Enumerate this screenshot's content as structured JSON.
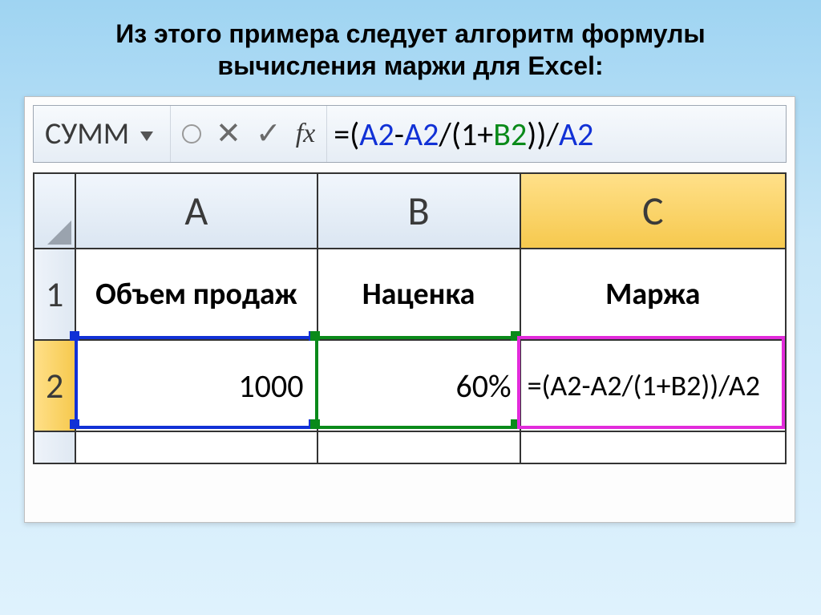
{
  "title": "Из этого примера следует алгоритм формулы вычисления маржи для Excel:",
  "namebox": "СУММ",
  "formula": {
    "eq": "=",
    "lpar": "(",
    "a2_1": "A2",
    "minus": "-",
    "a2_2": "A2",
    "slash1": "/",
    "lpar2": "(",
    "one": "1",
    "plus": "+",
    "b2": "B2",
    "rpar2": ")",
    "rpar": ")",
    "slash2": "/",
    "a2_3": "A2"
  },
  "cols": {
    "a": "A",
    "b": "B",
    "c": "C"
  },
  "rows": {
    "r1": "1",
    "r2": "2"
  },
  "cells": {
    "a1": "Объем продаж",
    "b1": "Наценка",
    "c1": "Маржа",
    "a2": "1000",
    "b2": "60%",
    "c2": "=(A2-A2/(1+B2))/A2"
  },
  "icons": {
    "cancel": "✕",
    "enter": "✓",
    "fx": "fx"
  }
}
